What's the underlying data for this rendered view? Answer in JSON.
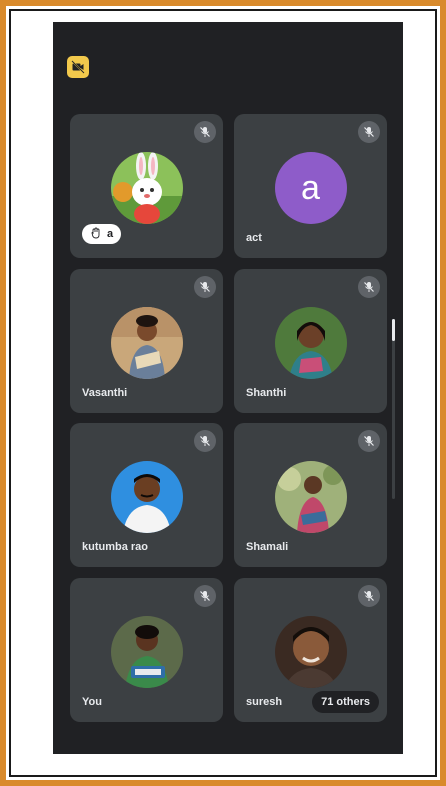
{
  "participants": [
    {
      "name": "a",
      "hand_raised": true,
      "avatar": "bunny-photo",
      "muted": true
    },
    {
      "name": "act",
      "avatar_letter": "a",
      "muted": true
    },
    {
      "name": "Vasanthi",
      "avatar": "photo",
      "muted": true
    },
    {
      "name": "Shanthi",
      "avatar": "photo",
      "muted": true
    },
    {
      "name": "kutumba rao",
      "avatar": "photo",
      "muted": true
    },
    {
      "name": "Shamali",
      "avatar": "photo",
      "muted": true
    },
    {
      "name": "You",
      "avatar": "photo",
      "muted": true
    },
    {
      "name": "suresh",
      "avatar": "photo",
      "muted": true
    }
  ],
  "others_label": "71 others",
  "colors": {
    "background": "#202124",
    "tile": "#3c4043",
    "camera_off_badge": "#f2c94c",
    "letter_avatar": "#8e5cc9",
    "frame_border": "#d98a2b"
  },
  "icons": [
    "camera-off-icon",
    "mic-off-icon",
    "raised-hand-icon"
  ]
}
